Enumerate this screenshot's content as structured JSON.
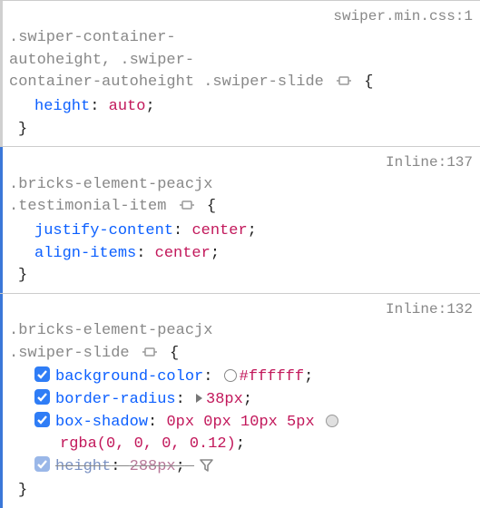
{
  "rules": [
    {
      "bar": "gray",
      "source": "swiper.min.css:1",
      "selector_line1": ".swiper-container-",
      "selector_line2": "autoheight, .swiper-",
      "selector_line3": "container-autoheight .swiper-slide",
      "brace_open": "{",
      "prop_height_name": "height",
      "prop_height_val": "auto",
      "brace_close": "}"
    },
    {
      "bar": "blue",
      "source": "Inline:137",
      "selector_line1": ".bricks-element-peacjx",
      "selector_line2": ".testimonial-item",
      "brace_open": "{",
      "prop_jc_name": "justify-content",
      "prop_jc_val": "center",
      "prop_ai_name": "align-items",
      "prop_ai_val": "center",
      "brace_close": "}"
    },
    {
      "bar": "blue",
      "source": "Inline:132",
      "selector_line1": ".bricks-element-peacjx",
      "selector_line2": ".swiper-slide",
      "brace_open": "{",
      "prop_bg_name": "background-color",
      "prop_bg_val": "#ffffff",
      "prop_br_name": "border-radius",
      "prop_br_val": "38px",
      "prop_bs_name": "box-shadow",
      "prop_bs_val1": "0px 0px 10px 5px",
      "prop_bs_val2": "rgba(0, 0, 0, 0.12)",
      "prop_h_name": "height",
      "prop_h_val": "288px",
      "brace_close": "}"
    }
  ]
}
